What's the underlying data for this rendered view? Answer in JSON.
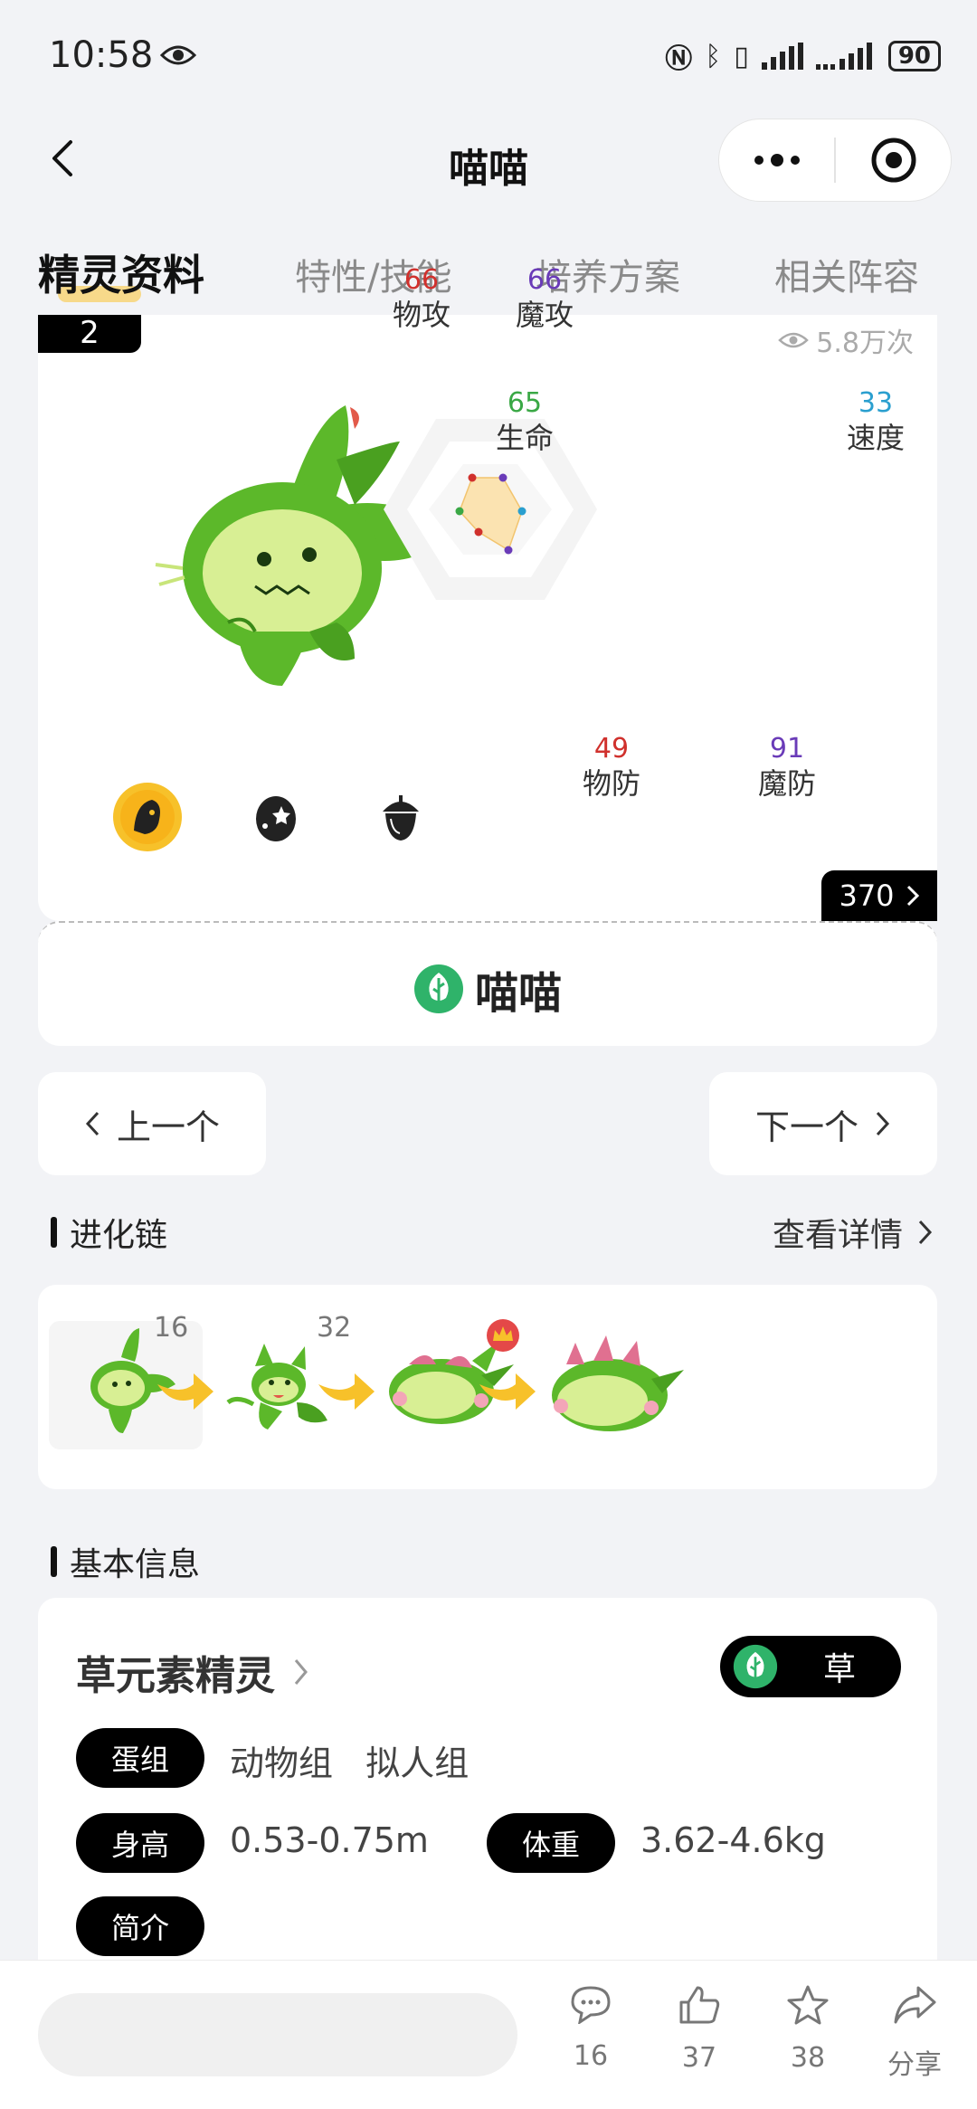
{
  "status": {
    "time": "10:58",
    "battery": "90"
  },
  "nav": {
    "title": "喵喵"
  },
  "tabs": [
    "精灵资料",
    "特性/技能",
    "培养方案",
    "相关阵容"
  ],
  "profile": {
    "number": "2",
    "views": "5.8万次",
    "total": "370",
    "name": "喵喵",
    "stats": {
      "phys_atk": {
        "label": "物攻",
        "value": "66",
        "color": "#d0312d"
      },
      "mag_atk": {
        "label": "魔攻",
        "value": "66",
        "color": "#6a3bb8"
      },
      "hp": {
        "label": "生命",
        "value": "65",
        "color": "#3aa845"
      },
      "speed": {
        "label": "速度",
        "value": "33",
        "color": "#2a9fcf"
      },
      "phys_def": {
        "label": "物防",
        "value": "49",
        "color": "#d0312d"
      },
      "mag_def": {
        "label": "魔防",
        "value": "91",
        "color": "#6a3bb8"
      }
    }
  },
  "pager": {
    "prev": "上一个",
    "next": "下一个"
  },
  "evolution": {
    "title": "进化链",
    "see_more": "查看详情",
    "levels": [
      "16",
      "32"
    ]
  },
  "basic": {
    "title": "基本信息",
    "category": "草元素精灵",
    "type": "草",
    "egg_group_label": "蛋组",
    "egg_groups": "动物组   拟人组",
    "height_label": "身高",
    "height": "0.53-0.75m",
    "weight_label": "体重",
    "weight": "3.62-4.6kg",
    "intro_label": "简介"
  },
  "bottom": {
    "comments": "16",
    "likes": "37",
    "favorites": "38",
    "share": "分享"
  },
  "colors": {
    "accent_yellow": "#f7c12a",
    "grass_green": "#2fb36a"
  }
}
